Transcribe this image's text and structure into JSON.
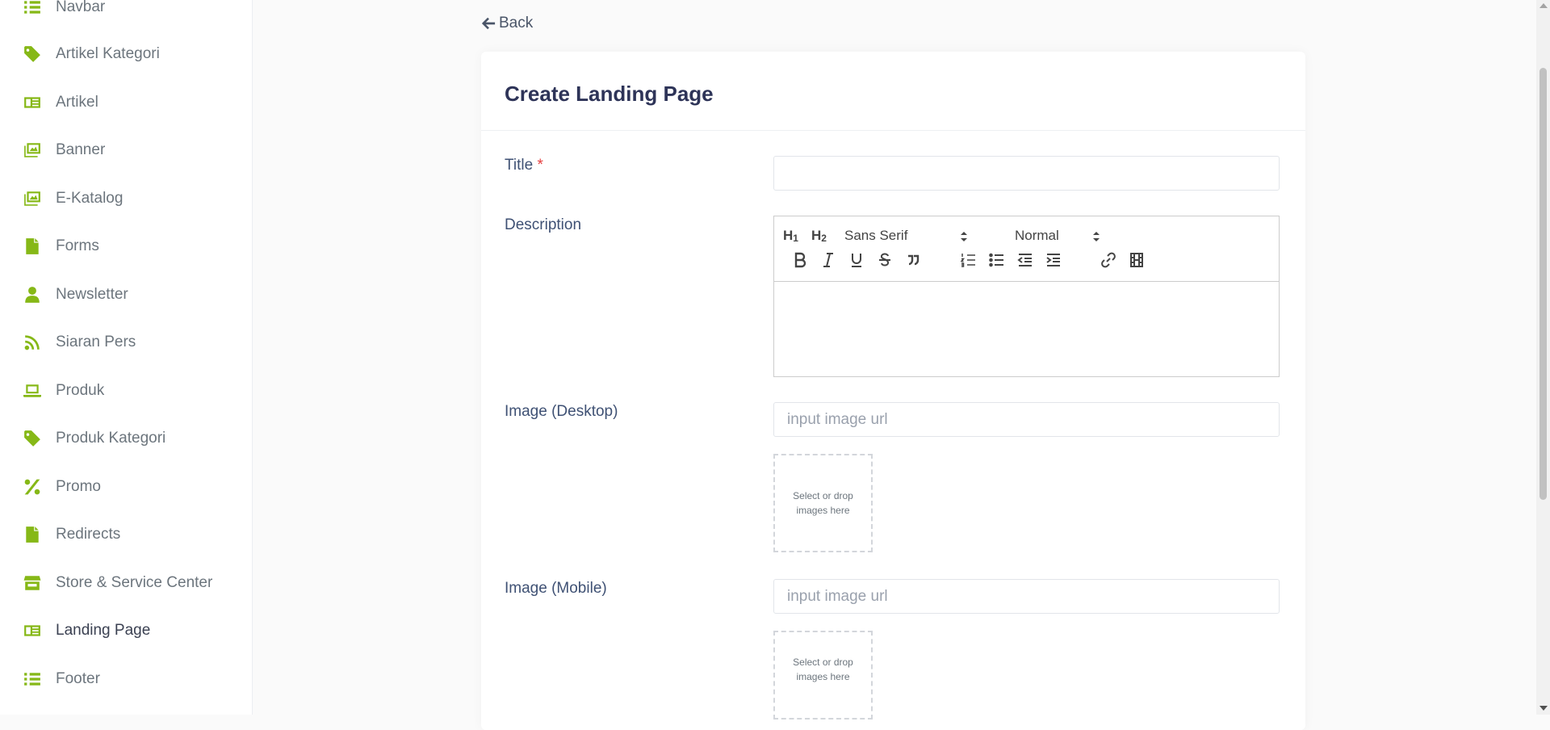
{
  "sidebar": {
    "items": [
      {
        "label": "Navbar",
        "icon": "list-icon"
      },
      {
        "label": "Artikel Kategori",
        "icon": "tag-icon"
      },
      {
        "label": "Artikel",
        "icon": "newspaper-icon"
      },
      {
        "label": "Banner",
        "icon": "images-icon"
      },
      {
        "label": "E-Katalog",
        "icon": "images-icon"
      },
      {
        "label": "Forms",
        "icon": "file-icon"
      },
      {
        "label": "Newsletter",
        "icon": "user-icon"
      },
      {
        "label": "Siaran Pers",
        "icon": "rss-icon"
      },
      {
        "label": "Produk",
        "icon": "laptop-icon"
      },
      {
        "label": "Produk Kategori",
        "icon": "tag-icon"
      },
      {
        "label": "Promo",
        "icon": "percent-icon"
      },
      {
        "label": "Redirects",
        "icon": "file-icon"
      },
      {
        "label": "Store & Service Center",
        "icon": "store-icon"
      },
      {
        "label": "Landing Page",
        "icon": "newspaper-icon",
        "active": true
      },
      {
        "label": "Footer",
        "icon": "list-icon"
      }
    ],
    "accent": "#86b817"
  },
  "back_label": "Back",
  "card": {
    "title": "Create Landing Page"
  },
  "form": {
    "title_label": "Title",
    "required_mark": "*",
    "title_value": "",
    "description_label": "Description",
    "editor": {
      "h1": "H1",
      "h2": "H2",
      "font_value": "Sans Serif",
      "size_value": "Normal"
    },
    "image_desktop_label": "Image (Desktop)",
    "image_desktop_placeholder": "input image url",
    "image_mobile_label": "Image (Mobile)",
    "image_mobile_placeholder": "input image url",
    "dropzone_line1": "Select or drop",
    "dropzone_line2": "images here"
  }
}
